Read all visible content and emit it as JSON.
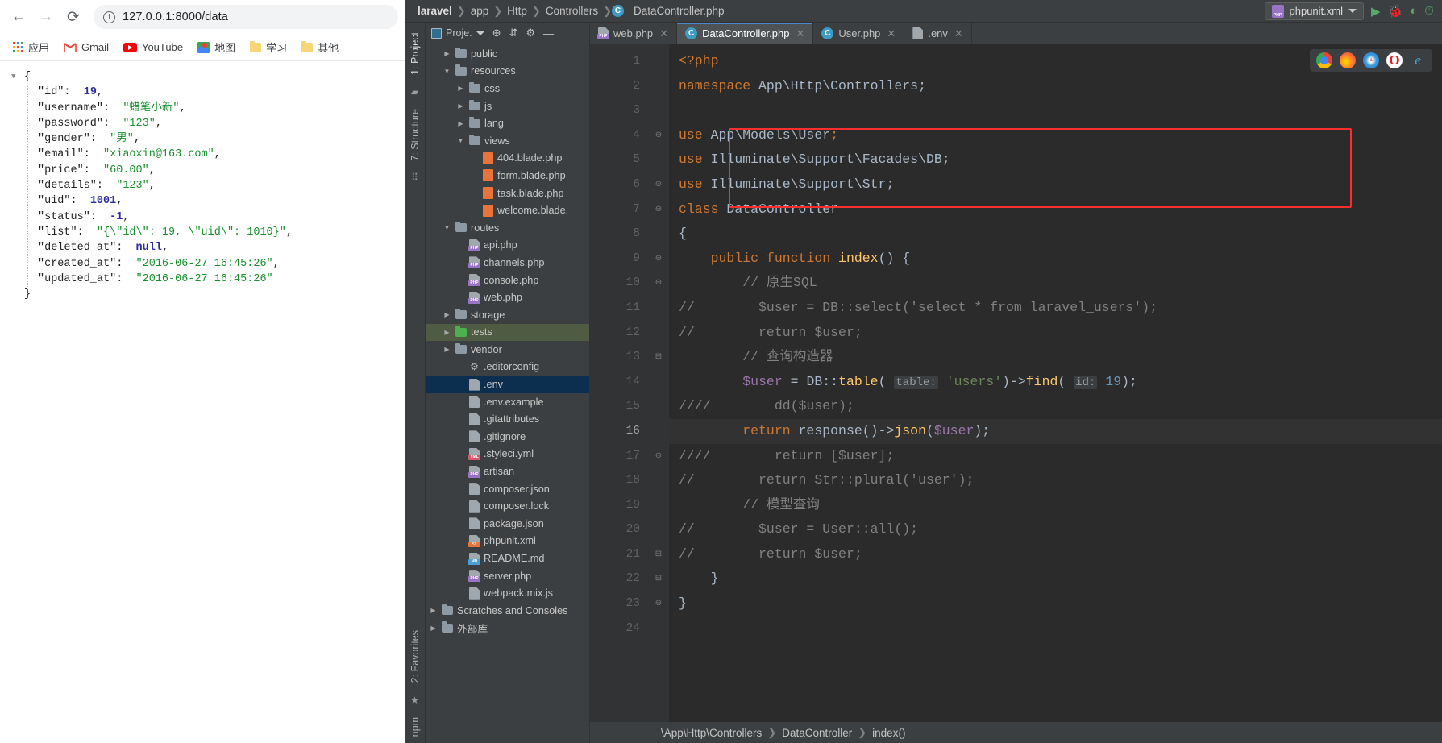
{
  "browser": {
    "nav": {
      "back": "←",
      "forward": "→",
      "reload": "⟳",
      "info_icon": "i"
    },
    "url": "127.0.0.1:8000/data",
    "bookmarks": [
      {
        "label": "应用",
        "icon": "apps-grid-icon"
      },
      {
        "label": "Gmail",
        "icon": "gmail-icon"
      },
      {
        "label": "YouTube",
        "icon": "youtube-icon"
      },
      {
        "label": "地图",
        "icon": "maps-icon"
      },
      {
        "label": "学习",
        "icon": "folder-icon"
      },
      {
        "label": "其他",
        "icon": "folder-icon"
      }
    ],
    "json_response": {
      "open_brace": "{",
      "close_brace": "}",
      "entries": [
        {
          "key": "\"id\"",
          "value": "19",
          "type": "num",
          "comma": ","
        },
        {
          "key": "\"username\"",
          "value": "\"蜡笔小新\"",
          "type": "str",
          "comma": ","
        },
        {
          "key": "\"password\"",
          "value": "\"123\"",
          "type": "str",
          "comma": ","
        },
        {
          "key": "\"gender\"",
          "value": "\"男\"",
          "type": "str",
          "comma": ","
        },
        {
          "key": "\"email\"",
          "value": "\"xiaoxin@163.com\"",
          "type": "str",
          "comma": ","
        },
        {
          "key": "\"price\"",
          "value": "\"60.00\"",
          "type": "str",
          "comma": ","
        },
        {
          "key": "\"details\"",
          "value": "\"123\"",
          "type": "str",
          "comma": ","
        },
        {
          "key": "\"uid\"",
          "value": "1001",
          "type": "num",
          "comma": ","
        },
        {
          "key": "\"status\"",
          "value": "-1",
          "type": "num",
          "comma": ","
        },
        {
          "key": "\"list\"",
          "value": "\"{\\\"id\\\": 19, \\\"uid\\\": 1010}\"",
          "type": "str",
          "comma": ","
        },
        {
          "key": "\"deleted_at\"",
          "value": "null",
          "type": "null",
          "comma": ","
        },
        {
          "key": "\"created_at\"",
          "value": "\"2016-06-27 16:45:26\"",
          "type": "str",
          "comma": ","
        },
        {
          "key": "\"updated_at\"",
          "value": "\"2016-06-27 16:45:26\"",
          "type": "str",
          "comma": ""
        }
      ]
    }
  },
  "ide": {
    "breadcrumb_top": [
      "laravel",
      "app",
      "Http",
      "Controllers",
      "DataController.php"
    ],
    "run_config": {
      "label": "phpunit.xml",
      "icon": "phpunit-xml-icon"
    },
    "run_buttons": [
      "run-icon",
      "debug-icon",
      "coverage-icon",
      "profile-icon"
    ],
    "rails_left": [
      "1: Project",
      "7: Structure",
      "2: Favorites"
    ],
    "rail_bottom": "npm",
    "project_panel": {
      "title": "Proje.",
      "toolbar_icons": [
        "locate-icon",
        "collapse-all-icon",
        "settings-gear-icon",
        "hide-icon"
      ],
      "tree": [
        {
          "label": "public",
          "depth": 1,
          "arrow": "▶",
          "kind": "folder"
        },
        {
          "label": "resources",
          "depth": 1,
          "arrow": "▼",
          "kind": "folder"
        },
        {
          "label": "css",
          "depth": 2,
          "arrow": "▶",
          "kind": "folder"
        },
        {
          "label": "js",
          "depth": 2,
          "arrow": "▶",
          "kind": "folder"
        },
        {
          "label": "lang",
          "depth": 2,
          "arrow": "▶",
          "kind": "folder"
        },
        {
          "label": "views",
          "depth": 2,
          "arrow": "▼",
          "kind": "folder"
        },
        {
          "label": "404.blade.php",
          "depth": 3,
          "arrow": "",
          "kind": "blade"
        },
        {
          "label": "form.blade.php",
          "depth": 3,
          "arrow": "",
          "kind": "blade"
        },
        {
          "label": "task.blade.php",
          "depth": 3,
          "arrow": "",
          "kind": "blade"
        },
        {
          "label": "welcome.blade.",
          "depth": 3,
          "arrow": "",
          "kind": "blade"
        },
        {
          "label": "routes",
          "depth": 1,
          "arrow": "▼",
          "kind": "folder"
        },
        {
          "label": "api.php",
          "depth": 2,
          "arrow": "",
          "kind": "php"
        },
        {
          "label": "channels.php",
          "depth": 2,
          "arrow": "",
          "kind": "php"
        },
        {
          "label": "console.php",
          "depth": 2,
          "arrow": "",
          "kind": "php"
        },
        {
          "label": "web.php",
          "depth": 2,
          "arrow": "",
          "kind": "php"
        },
        {
          "label": "storage",
          "depth": 1,
          "arrow": "▶",
          "kind": "folder"
        },
        {
          "label": "tests",
          "depth": 1,
          "arrow": "▶",
          "kind": "folder-green",
          "state": "green"
        },
        {
          "label": "vendor",
          "depth": 1,
          "arrow": "▶",
          "kind": "folder"
        },
        {
          "label": ".editorconfig",
          "depth": 2,
          "arrow": "",
          "kind": "gear"
        },
        {
          "label": ".env",
          "depth": 2,
          "arrow": "",
          "kind": "file",
          "state": "selected"
        },
        {
          "label": ".env.example",
          "depth": 2,
          "arrow": "",
          "kind": "file"
        },
        {
          "label": ".gitattributes",
          "depth": 2,
          "arrow": "",
          "kind": "file"
        },
        {
          "label": ".gitignore",
          "depth": 2,
          "arrow": "",
          "kind": "file-ignore"
        },
        {
          "label": ".styleci.yml",
          "depth": 2,
          "arrow": "",
          "kind": "yml"
        },
        {
          "label": "artisan",
          "depth": 2,
          "arrow": "",
          "kind": "php"
        },
        {
          "label": "composer.json",
          "depth": 2,
          "arrow": "",
          "kind": "file-json"
        },
        {
          "label": "composer.lock",
          "depth": 2,
          "arrow": "",
          "kind": "file-json"
        },
        {
          "label": "package.json",
          "depth": 2,
          "arrow": "",
          "kind": "file-json"
        },
        {
          "label": "phpunit.xml",
          "depth": 2,
          "arrow": "",
          "kind": "xmlr"
        },
        {
          "label": "README.md",
          "depth": 2,
          "arrow": "",
          "kind": "md"
        },
        {
          "label": "server.php",
          "depth": 2,
          "arrow": "",
          "kind": "php"
        },
        {
          "label": "webpack.mix.js",
          "depth": 2,
          "arrow": "",
          "kind": "file-js"
        },
        {
          "label": "Scratches and Consoles",
          "depth": 0,
          "arrow": "▶",
          "kind": "scratch"
        },
        {
          "label": "外部库",
          "depth": 0,
          "arrow": "▶",
          "kind": "lib"
        }
      ]
    },
    "tabs": [
      {
        "label": "web.php",
        "icon": "php-file-icon",
        "active": false,
        "close": "✕"
      },
      {
        "label": "DataController.php",
        "icon": "php-class-icon",
        "active": true,
        "close": "✕"
      },
      {
        "label": "User.php",
        "icon": "php-class-icon",
        "active": false,
        "close": "✕"
      },
      {
        "label": ".env",
        "icon": "env-file-icon",
        "active": false,
        "close": "✕"
      }
    ],
    "browser_preview_icons": [
      "chrome-icon",
      "firefox-icon",
      "safari-icon",
      "opera-icon",
      "ie-icon"
    ],
    "bottom_breadcrumb": [
      "\\App\\Http\\Controllers",
      "DataController",
      "index()"
    ],
    "code": {
      "line_numbers": [
        "1",
        "2",
        "3",
        "4",
        "5",
        "6",
        "7",
        "8",
        "9",
        "10",
        "11",
        "12",
        "13",
        "14",
        "15",
        "16",
        "17",
        "18",
        "19",
        "20",
        "21",
        "22",
        "23",
        "24"
      ],
      "current_line": 16,
      "lines": [
        {
          "n": 1,
          "tokens": [
            {
              "t": "<?php",
              "c": "kw"
            }
          ]
        },
        {
          "n": 2,
          "tokens": [
            {
              "t": "namespace ",
              "c": "kw"
            },
            {
              "t": "App\\Http\\Controllers;",
              "c": "plain"
            }
          ]
        },
        {
          "n": 3,
          "tokens": []
        },
        {
          "n": 4,
          "tokens": [
            {
              "t": "use ",
              "c": "kw"
            },
            {
              "t": "App\\Models\\User",
              "c": "plain"
            },
            {
              "t": ";",
              "c": "kw"
            }
          ]
        },
        {
          "n": 5,
          "tokens": [
            {
              "t": "use ",
              "c": "kw"
            },
            {
              "t": "Illuminate\\Support\\Facades\\DB;",
              "c": "plain"
            }
          ]
        },
        {
          "n": 6,
          "tokens": [
            {
              "t": "use ",
              "c": "kw"
            },
            {
              "t": "Illuminate\\Support\\Str;",
              "c": "plain"
            }
          ]
        },
        {
          "n": 7,
          "tokens": [
            {
              "t": "class ",
              "c": "kw"
            },
            {
              "t": "DataController",
              "c": "plain"
            }
          ]
        },
        {
          "n": 8,
          "tokens": [
            {
              "t": "{",
              "c": "plain"
            }
          ]
        },
        {
          "n": 9,
          "tokens": [
            {
              "t": "    ",
              "c": "plain"
            },
            {
              "t": "public function ",
              "c": "kw"
            },
            {
              "t": "index",
              "c": "fn"
            },
            {
              "t": "() {",
              "c": "plain"
            }
          ]
        },
        {
          "n": 10,
          "tokens": [
            {
              "t": "        ",
              "c": "plain"
            },
            {
              "t": "// 原生SQL",
              "c": "cmt"
            }
          ]
        },
        {
          "n": 11,
          "tokens": [
            {
              "t": "//",
              "c": "cmt"
            },
            {
              "t": "        $user = DB::select('select * from laravel_users');",
              "c": "cmt"
            }
          ]
        },
        {
          "n": 12,
          "tokens": [
            {
              "t": "//",
              "c": "cmt"
            },
            {
              "t": "        return $user;",
              "c": "cmt"
            }
          ]
        },
        {
          "n": 13,
          "tokens": [
            {
              "t": "        ",
              "c": "plain"
            },
            {
              "t": "// 查询构造器",
              "c": "cmt"
            }
          ]
        },
        {
          "n": 14,
          "tokens": [
            {
              "t": "        ",
              "c": "plain"
            },
            {
              "t": "$user",
              "c": "var"
            },
            {
              "t": " = ",
              "c": "plain"
            },
            {
              "t": "DB",
              "c": "plain"
            },
            {
              "t": "::",
              "c": "plain"
            },
            {
              "t": "table",
              "c": "fn"
            },
            {
              "t": "( ",
              "c": "plain"
            },
            {
              "t": "table:",
              "c": "hint"
            },
            {
              "t": " ",
              "c": "plain"
            },
            {
              "t": "'users'",
              "c": "str"
            },
            {
              "t": ")->",
              "c": "plain"
            },
            {
              "t": "find",
              "c": "fn"
            },
            {
              "t": "( ",
              "c": "plain"
            },
            {
              "t": "id:",
              "c": "hint"
            },
            {
              "t": " ",
              "c": "plain"
            },
            {
              "t": "19",
              "c": "num"
            },
            {
              "t": ");",
              "c": "plain"
            }
          ]
        },
        {
          "n": 15,
          "tokens": [
            {
              "t": "////",
              "c": "cmt"
            },
            {
              "t": "        dd($user);",
              "c": "cmt"
            }
          ]
        },
        {
          "n": 16,
          "tokens": [
            {
              "t": "        ",
              "c": "plain"
            },
            {
              "t": "return ",
              "c": "kw"
            },
            {
              "t": "response",
              "c": "plain"
            },
            {
              "t": "()->",
              "c": "plain"
            },
            {
              "t": "json",
              "c": "fn"
            },
            {
              "t": "(",
              "c": "plain"
            },
            {
              "t": "$user",
              "c": "var"
            },
            {
              "t": ");",
              "c": "plain"
            }
          ]
        },
        {
          "n": 17,
          "tokens": [
            {
              "t": "////",
              "c": "cmt"
            },
            {
              "t": "        return [$user];",
              "c": "cmt"
            }
          ]
        },
        {
          "n": 18,
          "tokens": [
            {
              "t": "//",
              "c": "cmt"
            },
            {
              "t": "        return Str::plural('user');",
              "c": "cmt"
            }
          ]
        },
        {
          "n": 19,
          "tokens": [
            {
              "t": "        ",
              "c": "plain"
            },
            {
              "t": "// 模型查询",
              "c": "cmt"
            }
          ]
        },
        {
          "n": 20,
          "tokens": [
            {
              "t": "//",
              "c": "cmt"
            },
            {
              "t": "        $user = User::all();",
              "c": "cmt"
            }
          ]
        },
        {
          "n": 21,
          "tokens": [
            {
              "t": "//",
              "c": "cmt"
            },
            {
              "t": "        return $user;",
              "c": "cmt"
            }
          ]
        },
        {
          "n": 22,
          "tokens": [
            {
              "t": "    }",
              "c": "plain"
            }
          ]
        },
        {
          "n": 23,
          "tokens": [
            {
              "t": "}",
              "c": "plain"
            }
          ]
        },
        {
          "n": 24,
          "tokens": []
        }
      ]
    }
  }
}
